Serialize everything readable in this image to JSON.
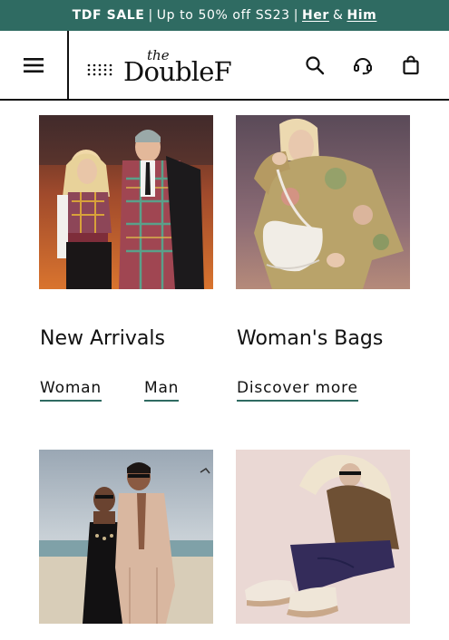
{
  "promo": {
    "sale_label": "TDF SALE",
    "separator": "|",
    "offer_text": "Up to 50% off SS23",
    "her_link": "Her",
    "and_text": "&",
    "him_link": "Him"
  },
  "header": {
    "logo_the": "the",
    "logo_brand": "DoubleF",
    "icons": [
      "menu-icon",
      "search-icon",
      "headset-icon",
      "shopping-bag-icon"
    ]
  },
  "categories": [
    {
      "title": "New Arrivals",
      "links": [
        "Woman",
        "Man"
      ]
    },
    {
      "title": "Woman's Bags",
      "links": [
        "Discover more"
      ]
    }
  ],
  "colors": {
    "accent": "#2f6b62",
    "text": "#111111",
    "background": "#ffffff"
  }
}
